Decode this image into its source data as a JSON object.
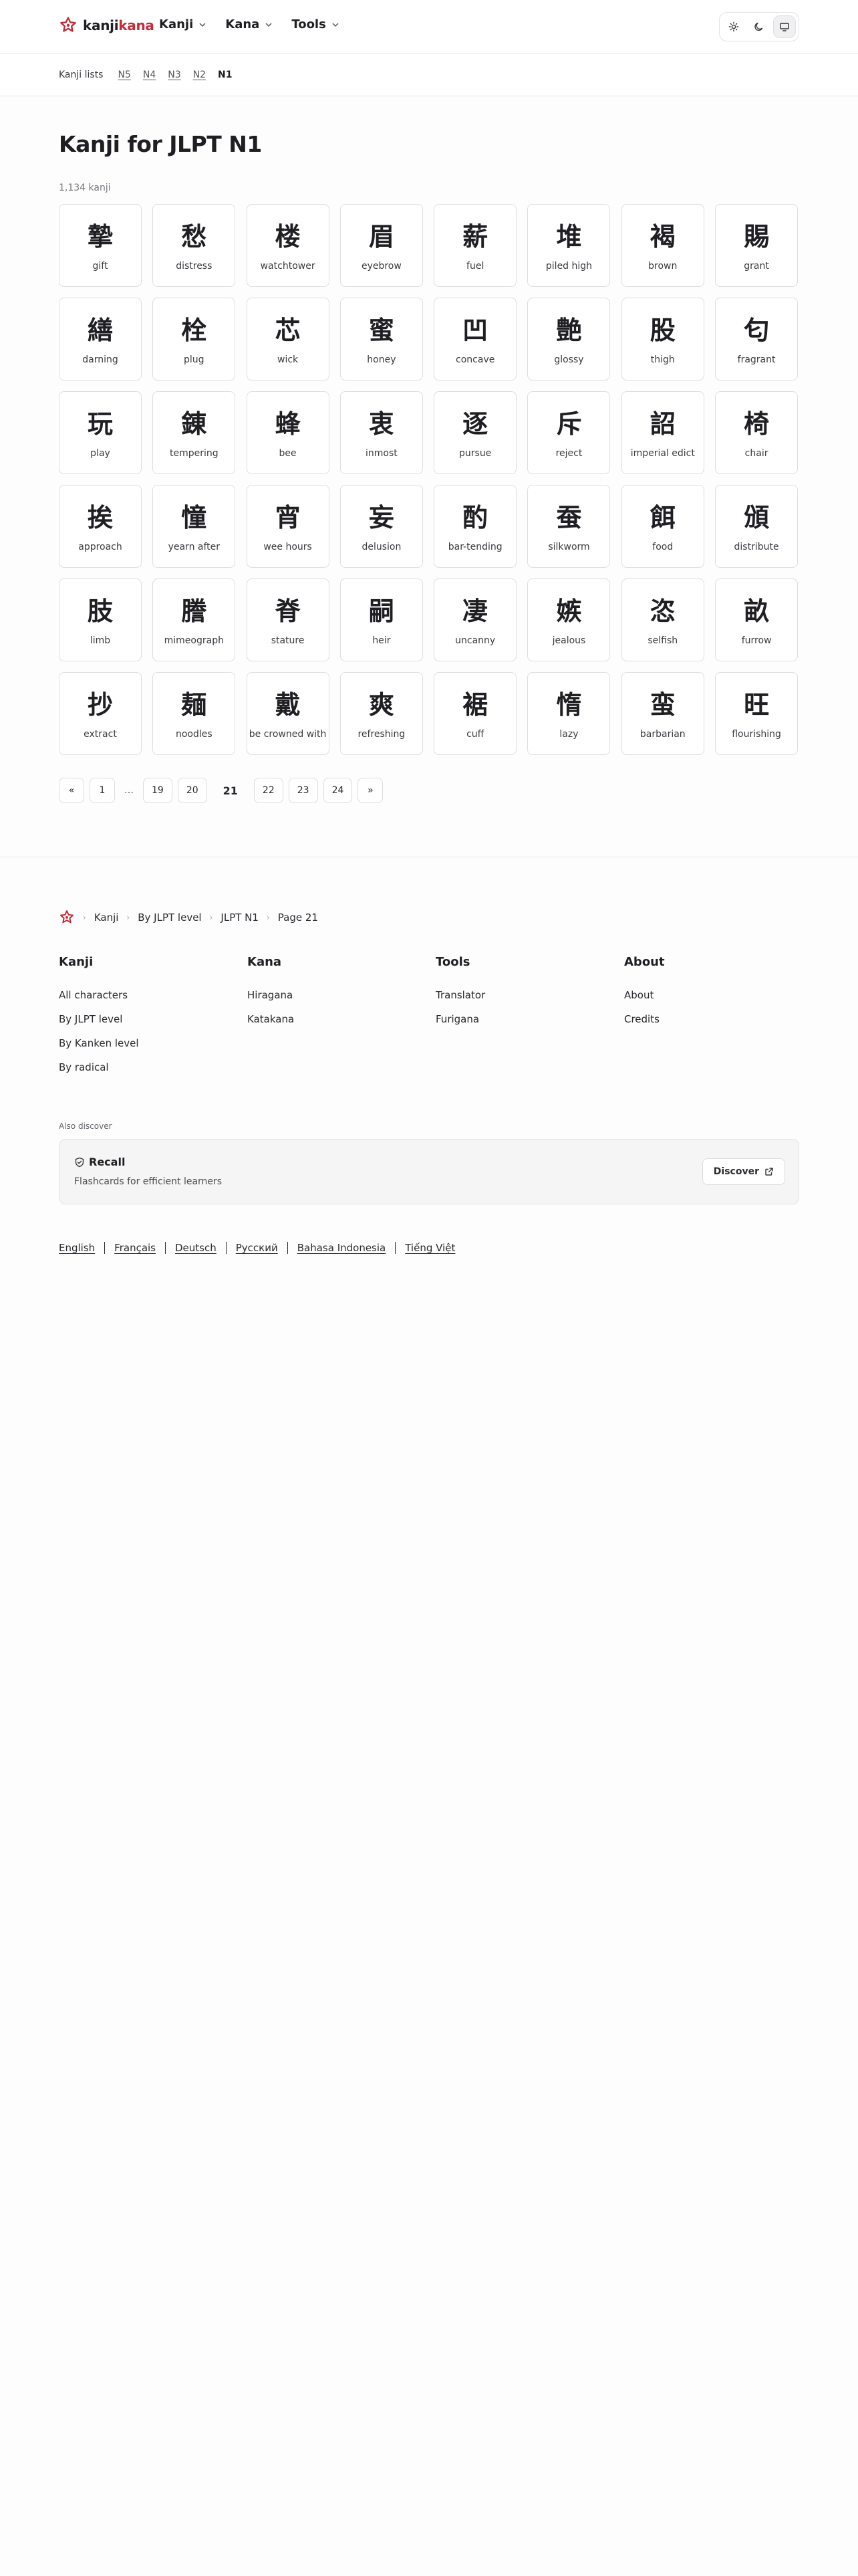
{
  "brand": {
    "part1": "kanji",
    "part2": "kana"
  },
  "nav": [
    {
      "label": "Kanji"
    },
    {
      "label": "Kana"
    },
    {
      "label": "Tools"
    }
  ],
  "theme": {
    "options": [
      "light",
      "dark",
      "system"
    ],
    "selected": "system"
  },
  "subnav": {
    "lead": "Kanji lists",
    "levels": [
      "N5",
      "N4",
      "N3",
      "N2",
      "N1"
    ],
    "current": "N1"
  },
  "page": {
    "title": "Kanji for JLPT N1",
    "count": "1,134 kanji"
  },
  "kanji": [
    {
      "char": "摯",
      "meaning": "gift"
    },
    {
      "char": "愁",
      "meaning": "distress"
    },
    {
      "char": "楼",
      "meaning": "watchtower"
    },
    {
      "char": "眉",
      "meaning": "eyebrow"
    },
    {
      "char": "薪",
      "meaning": "fuel"
    },
    {
      "char": "堆",
      "meaning": "piled high"
    },
    {
      "char": "褐",
      "meaning": "brown"
    },
    {
      "char": "賜",
      "meaning": "grant"
    },
    {
      "char": "繕",
      "meaning": "darning"
    },
    {
      "char": "栓",
      "meaning": "plug"
    },
    {
      "char": "芯",
      "meaning": "wick"
    },
    {
      "char": "蜜",
      "meaning": "honey"
    },
    {
      "char": "凹",
      "meaning": "concave"
    },
    {
      "char": "艶",
      "meaning": "glossy"
    },
    {
      "char": "股",
      "meaning": "thigh"
    },
    {
      "char": "匂",
      "meaning": "fragrant"
    },
    {
      "char": "玩",
      "meaning": "play"
    },
    {
      "char": "錬",
      "meaning": "tempering"
    },
    {
      "char": "蜂",
      "meaning": "bee"
    },
    {
      "char": "衷",
      "meaning": "inmost"
    },
    {
      "char": "逐",
      "meaning": "pursue"
    },
    {
      "char": "斥",
      "meaning": "reject"
    },
    {
      "char": "詔",
      "meaning": "imperial edict"
    },
    {
      "char": "椅",
      "meaning": "chair"
    },
    {
      "char": "挨",
      "meaning": "approach"
    },
    {
      "char": "憧",
      "meaning": "yearn after"
    },
    {
      "char": "宵",
      "meaning": "wee hours"
    },
    {
      "char": "妄",
      "meaning": "delusion"
    },
    {
      "char": "酌",
      "meaning": "bar-tending"
    },
    {
      "char": "蚕",
      "meaning": "silkworm"
    },
    {
      "char": "餌",
      "meaning": "food"
    },
    {
      "char": "頒",
      "meaning": "distribute"
    },
    {
      "char": "肢",
      "meaning": "limb"
    },
    {
      "char": "謄",
      "meaning": "mimeograph"
    },
    {
      "char": "脊",
      "meaning": "stature"
    },
    {
      "char": "嗣",
      "meaning": "heir"
    },
    {
      "char": "凄",
      "meaning": "uncanny"
    },
    {
      "char": "嫉",
      "meaning": "jealous"
    },
    {
      "char": "恣",
      "meaning": "selfish"
    },
    {
      "char": "畝",
      "meaning": "furrow"
    },
    {
      "char": "抄",
      "meaning": "extract"
    },
    {
      "char": "麺",
      "meaning": "noodles"
    },
    {
      "char": "戴",
      "meaning": "be crowned with"
    },
    {
      "char": "爽",
      "meaning": "refreshing"
    },
    {
      "char": "裾",
      "meaning": "cuff"
    },
    {
      "char": "惰",
      "meaning": "lazy"
    },
    {
      "char": "蛮",
      "meaning": "barbarian"
    },
    {
      "char": "旺",
      "meaning": "flourishing"
    }
  ],
  "pagination": {
    "prev": "«",
    "items": [
      "1",
      "…",
      "19",
      "20",
      "21",
      "22",
      "23",
      "24"
    ],
    "current": "21",
    "next": "»"
  },
  "footer": {
    "breadcrumb": [
      "Kanji",
      "By JLPT level",
      "JLPT N1",
      "Page 21"
    ],
    "columns": [
      {
        "title": "Kanji",
        "links": [
          "All characters",
          "By JLPT level",
          "By Kanken level",
          "By radical"
        ]
      },
      {
        "title": "Kana",
        "links": [
          "Hiragana",
          "Katakana"
        ]
      },
      {
        "title": "Tools",
        "links": [
          "Translator",
          "Furigana"
        ]
      },
      {
        "title": "About",
        "links": [
          "About",
          "Credits"
        ]
      }
    ],
    "also_discover": "Also discover",
    "promo": {
      "name": "Recall",
      "description": "Flashcards for efficient learners",
      "button": "Discover"
    },
    "languages": [
      "English",
      "Français",
      "Deutsch",
      "Русский",
      "Bahasa Indonesia",
      "Tiếng Việt"
    ]
  },
  "colors": {
    "accent": "#c22d38",
    "text": "#1f1f23",
    "border": "#dedee2"
  }
}
